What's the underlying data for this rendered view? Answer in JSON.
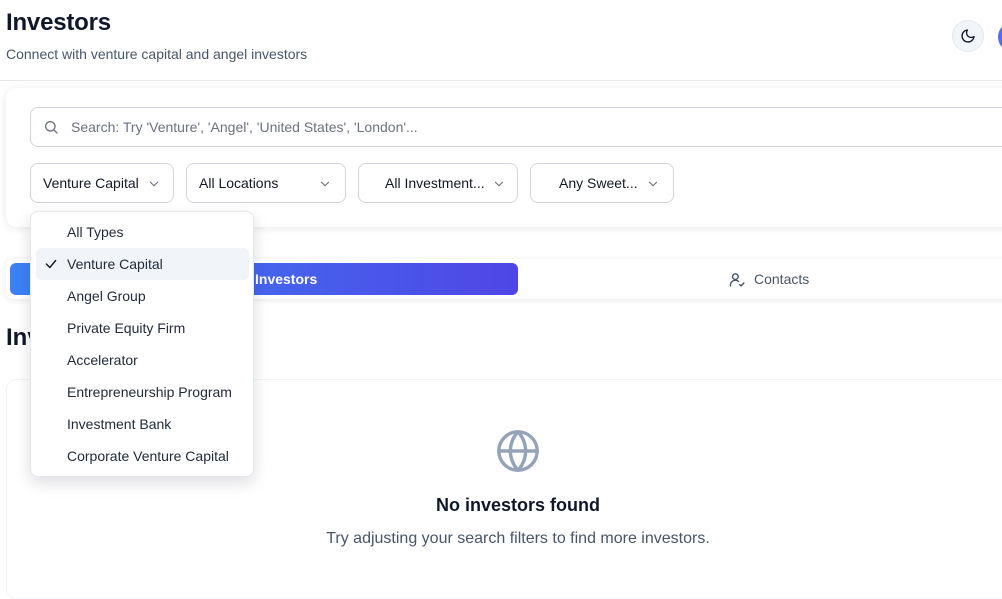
{
  "header": {
    "title": "Investors",
    "subtitle": "Connect with venture capital and angel investors"
  },
  "search": {
    "placeholder": "Search: Try 'Venture', 'Angel', 'United States', 'London'...",
    "value": ""
  },
  "filters": {
    "type": "Venture Capital",
    "location": "All Locations",
    "investment": "All Investment...",
    "sweet": "Any Sweet..."
  },
  "tabs": {
    "investors": "Investors",
    "contacts": "Contacts"
  },
  "section_title": "Investors",
  "empty_state": {
    "title": "No investors found",
    "description": "Try adjusting your search filters to find more investors."
  },
  "dropdown": {
    "selected": "Venture Capital",
    "items": [
      "All Types",
      "Venture Capital",
      "Angel Group",
      "Private Equity Firm",
      "Accelerator",
      "Entrepreneurship Program",
      "Investment Bank",
      "Corporate Venture Capital"
    ]
  },
  "colors": {
    "accent_start": "#3b82f6",
    "accent_end": "#4f46e5",
    "icon_gray": "#94a3b8"
  }
}
